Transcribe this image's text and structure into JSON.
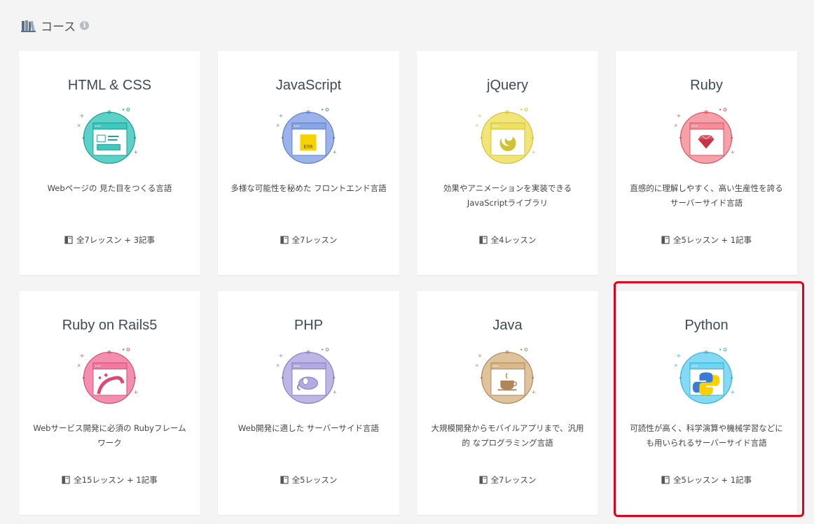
{
  "header": {
    "title": "コース",
    "info_icon": "info-icon",
    "books_icon": "books-icon"
  },
  "courses": [
    {
      "title": "HTML & CSS",
      "desc": "Webページの 見た目をつくる言語",
      "meta": "全7レッスン + 3記事",
      "color": "#3fc9be",
      "accent": "#1a9c92",
      "icon": "html-css-illustration"
    },
    {
      "title": "JavaScript",
      "desc": "多様な可能性を秘めた フロントエンド言語",
      "meta": "全7レッスン",
      "color": "#8aa6e6",
      "accent": "#5c7ccf",
      "icon": "javascript-illustration"
    },
    {
      "title": "jQuery",
      "desc": "効果やアニメーションを実装できる JavaScriptライブラリ",
      "meta": "全4レッスン",
      "color": "#eee061",
      "accent": "#d1c232",
      "icon": "jquery-illustration"
    },
    {
      "title": "Ruby",
      "desc": "直感的に理解しやすく、高い生産性を誇る サーバーサイド言語",
      "meta": "全5レッスン + 1記事",
      "color": "#f48f9a",
      "accent": "#e0505f",
      "icon": "ruby-illustration"
    },
    {
      "title": "Ruby on Rails5",
      "desc": "Webサービス開発に必須の Rubyフレームワーク",
      "meta": "全15レッスン + 1記事",
      "color": "#f27aa0",
      "accent": "#d84a78",
      "icon": "rails-illustration"
    },
    {
      "title": "PHP",
      "desc": "Web開発に適した サーバーサイド言語",
      "meta": "全5レッスン",
      "color": "#b3a9e0",
      "accent": "#8879c6",
      "icon": "php-illustration"
    },
    {
      "title": "Java",
      "desc": "大規模開発からモバイルアプリまで、汎用的 なプログラミング言語",
      "meta": "全7レッスン",
      "color": "#d9b98c",
      "accent": "#b08656",
      "icon": "java-illustration"
    },
    {
      "title": "Python",
      "desc": "可読性が高く、科学演算や機械学習などに も用いられるサーバーサイド言語",
      "meta": "全5レッスン + 1記事",
      "color": "#6fd4f2",
      "accent": "#33b0d8",
      "icon": "python-illustration"
    }
  ],
  "highlight": {
    "color": "#e0001b",
    "target": "Python"
  }
}
